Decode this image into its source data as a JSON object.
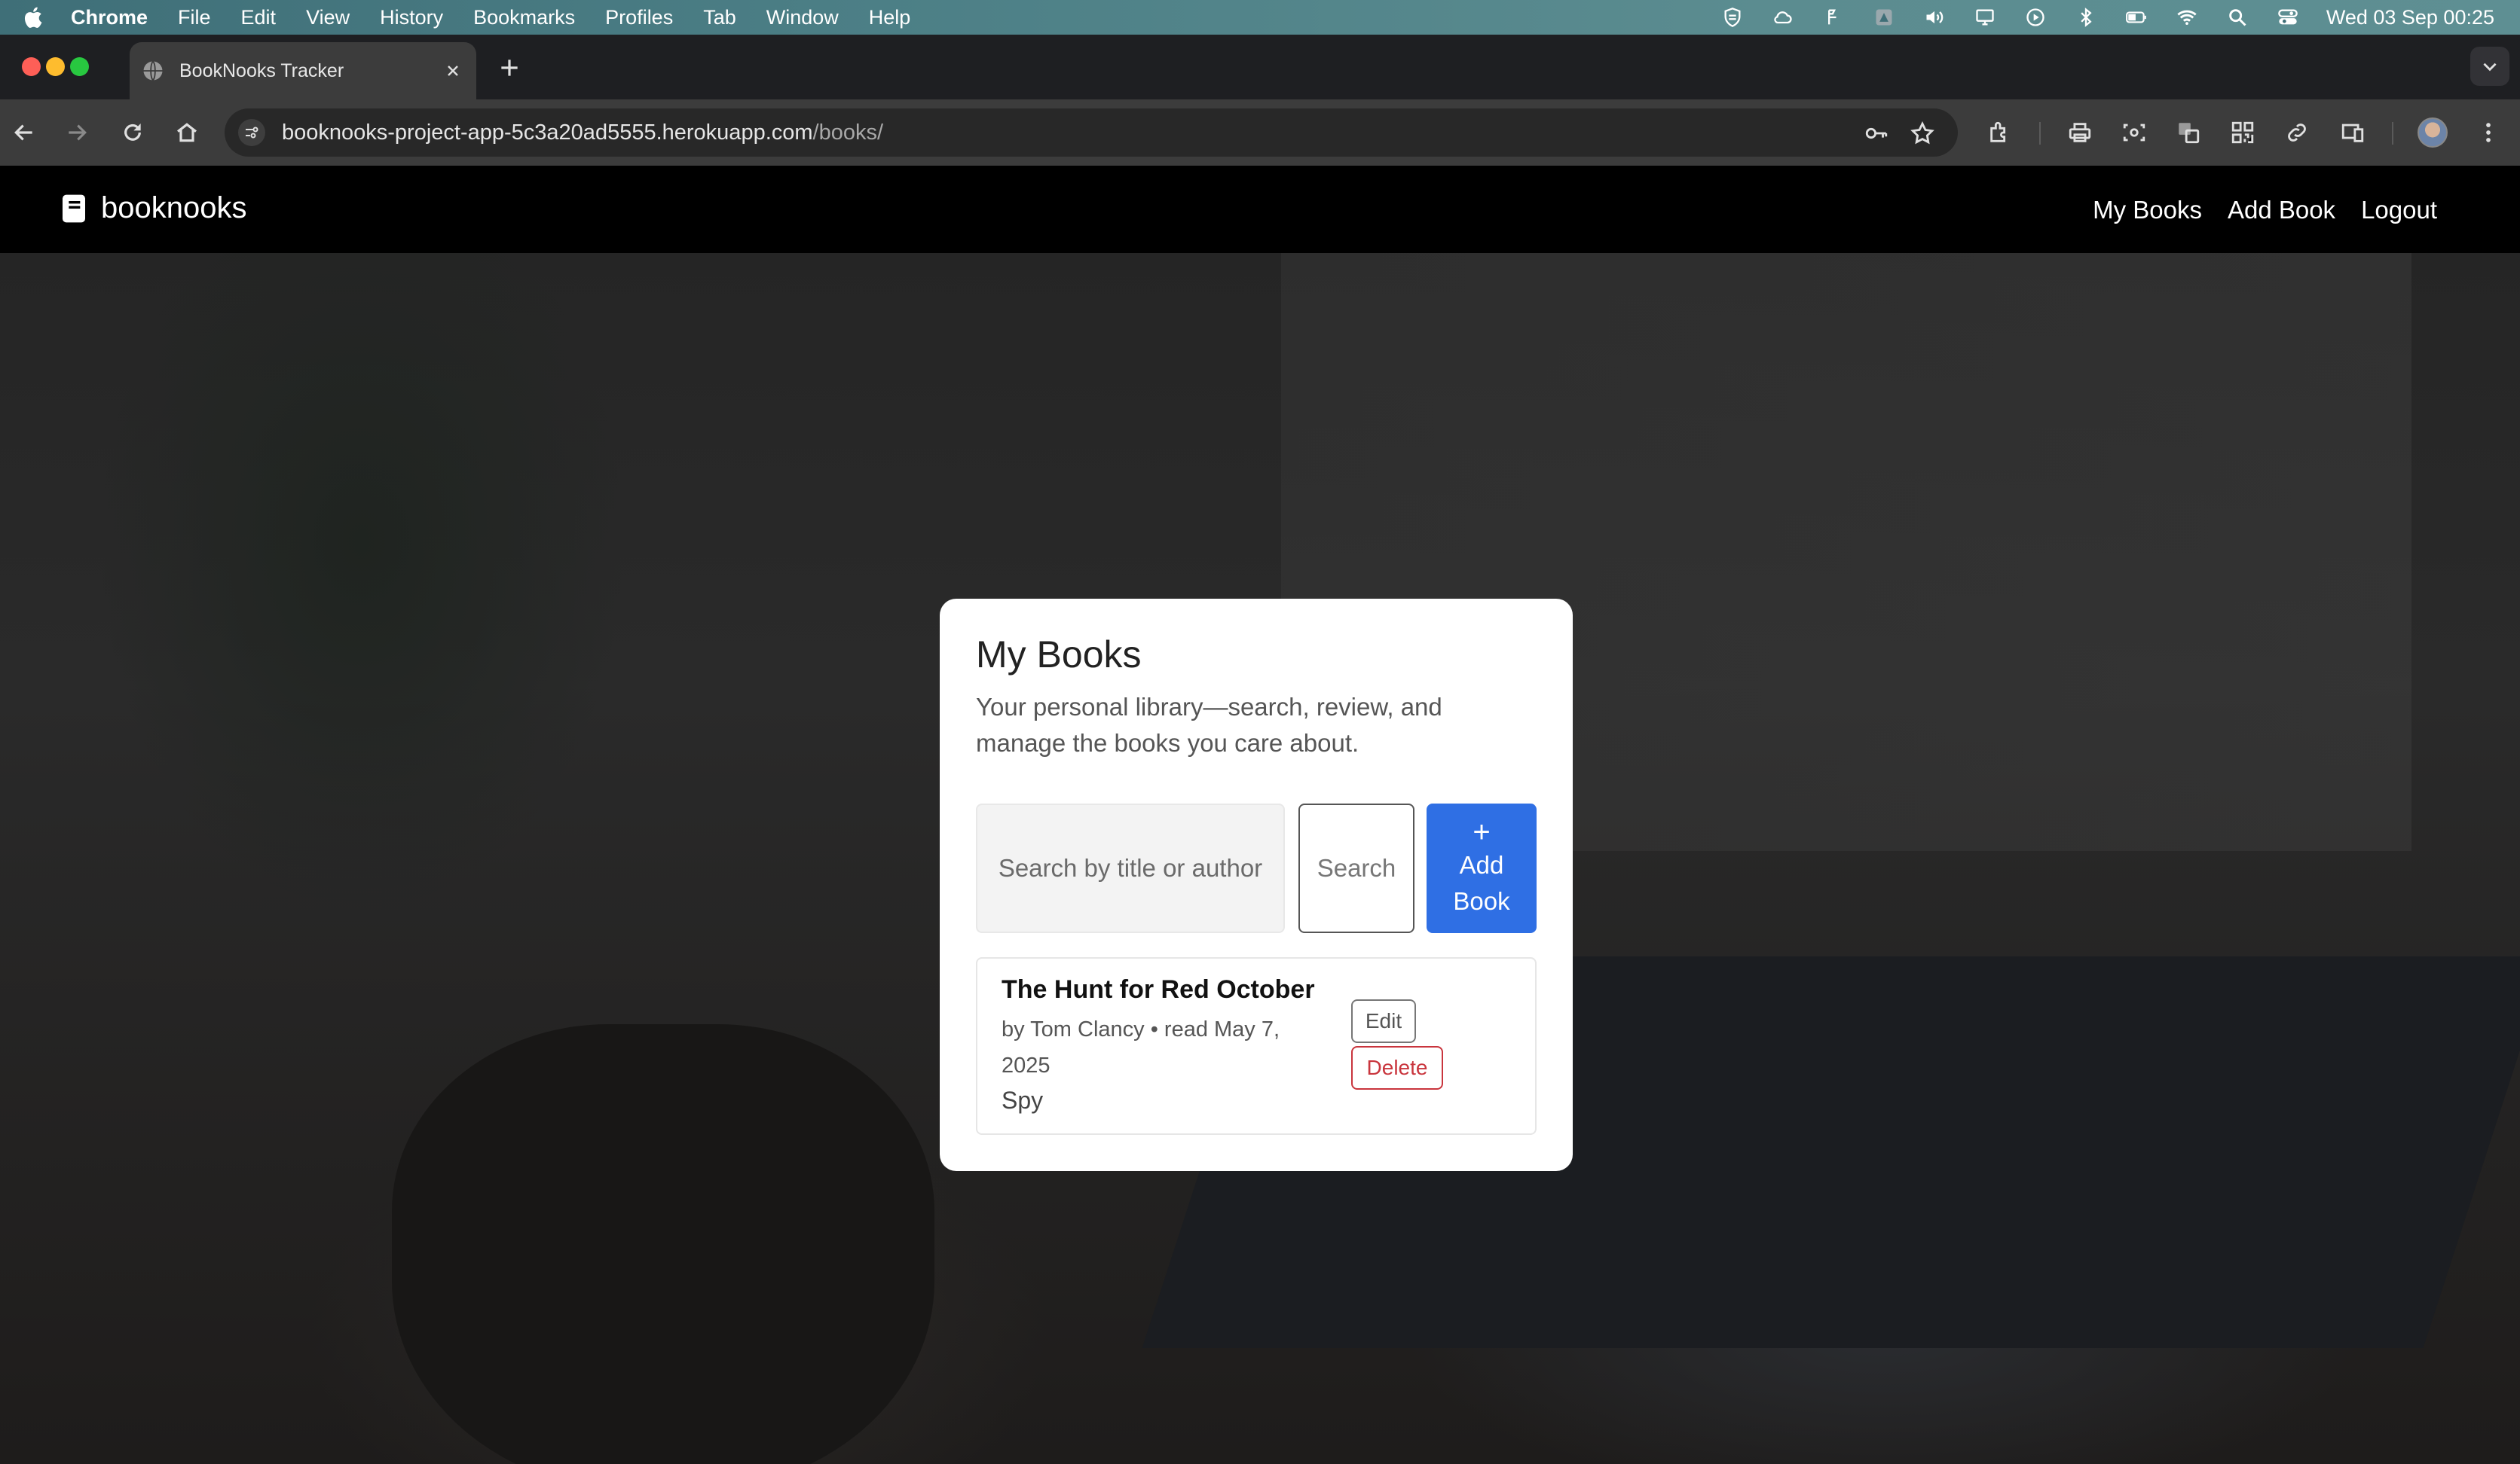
{
  "menubar": {
    "items": [
      "Chrome",
      "File",
      "Edit",
      "View",
      "History",
      "Bookmarks",
      "Profiles",
      "Tab",
      "Window",
      "Help"
    ],
    "clock": "Wed 03 Sep  00:25",
    "status_icons": [
      "shield-icon",
      "cloud-icon",
      "relay-icon",
      "app-icon",
      "volume-icon",
      "display-icon",
      "play-icon",
      "bluetooth-icon",
      "battery-icon",
      "wifi-icon",
      "search-icon",
      "control-center-icon"
    ]
  },
  "browser": {
    "tab_title": "BookNooks Tracker",
    "url_domain": "booknooks-project-app-5c3a20ad5555.herokuapp.com",
    "url_path": "/books/"
  },
  "site": {
    "brand": "booknooks",
    "nav": [
      "My Books",
      "Add Book",
      "Logout"
    ]
  },
  "main": {
    "title": "My Books",
    "subtitle": "Your personal library—search, review, and manage the books you care about.",
    "search_placeholder": "Search by title or author",
    "search_button": "Search",
    "add_button_plus": "+",
    "add_button_label": "Add Book"
  },
  "books": [
    {
      "title": "The Hunt for Red October",
      "meta": "by Tom Clancy • read May 7, 2025",
      "genre": "Spy",
      "edit_label": "Edit",
      "delete_label": "Delete"
    }
  ],
  "colors": {
    "primary": "#2f6fe4",
    "danger": "#c9353d",
    "navbar": "#000000"
  }
}
